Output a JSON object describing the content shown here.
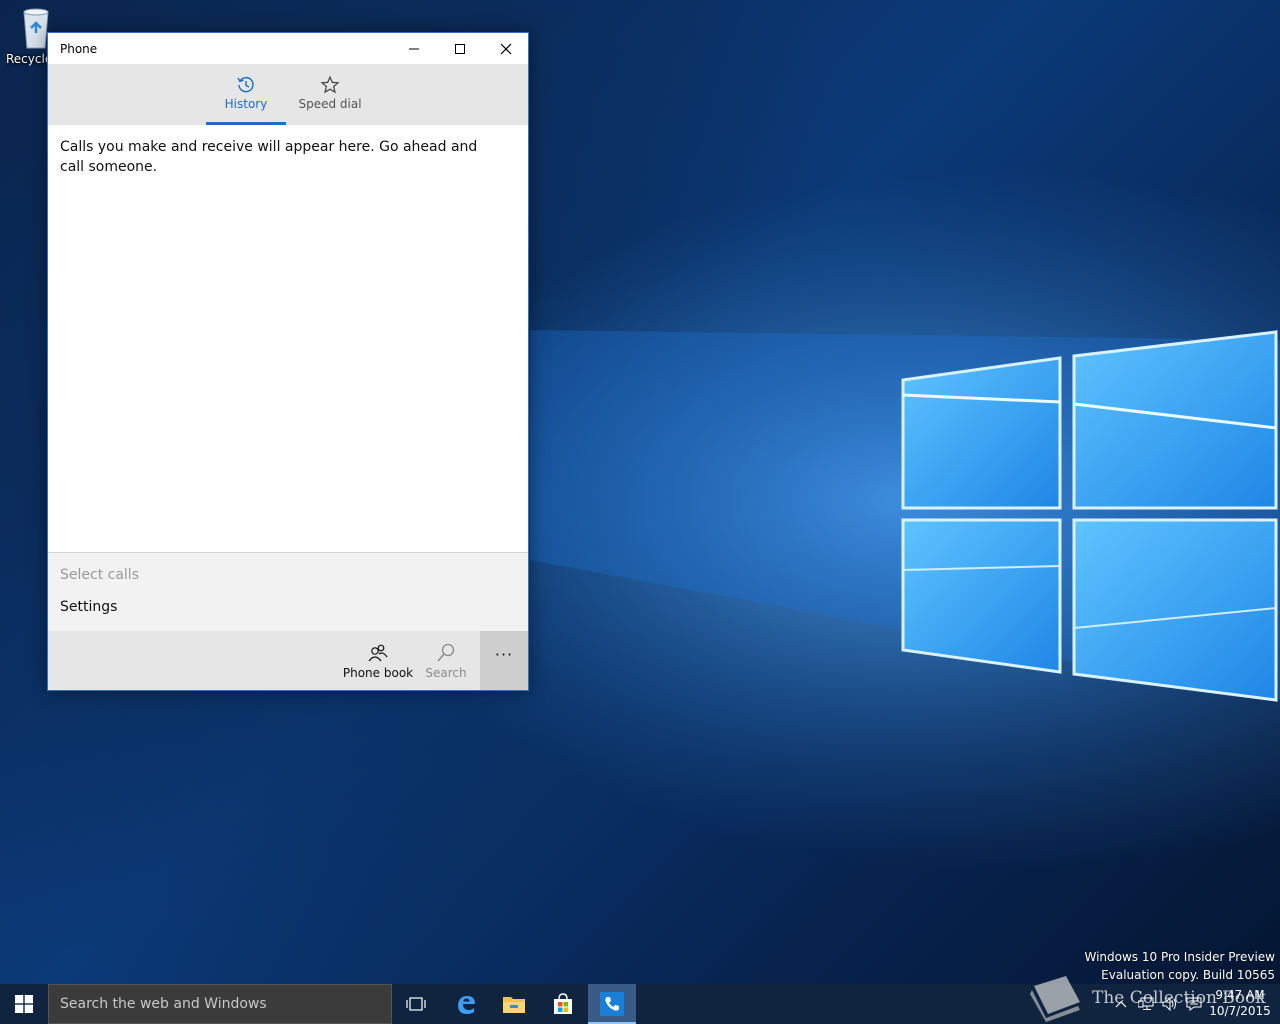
{
  "desktop": {
    "recycle_bin_label": "Recycle Bin"
  },
  "window": {
    "title": "Phone",
    "controls": {
      "minimize": "minimize-icon",
      "maximize": "maximize-icon",
      "close": "close-icon"
    },
    "tabs": [
      {
        "label": "History",
        "icon": "history-icon",
        "selected": true
      },
      {
        "label": "Speed dial",
        "icon": "star-icon",
        "selected": false
      }
    ],
    "empty_message": "Calls you make and receive will appear here. Go ahead and call someone.",
    "menu": {
      "select_calls": "Select calls",
      "settings": "Settings"
    },
    "appbar": {
      "phone_book": "Phone book",
      "search": "Search",
      "more": "···"
    },
    "accent_color": "#1b6ec2"
  },
  "watermark": {
    "line1": "Windows 10 Pro Insider Preview",
    "line2": "Evaluation copy. Build 10565",
    "overlay_text": "The Collection Book"
  },
  "taskbar": {
    "search_placeholder": "Search the web and Windows",
    "pinned": [
      "task-view-icon",
      "edge-icon",
      "file-explorer-icon",
      "store-icon",
      "phone-icon"
    ],
    "clock_time": "9:47 AM",
    "clock_date": "10/7/2015"
  }
}
